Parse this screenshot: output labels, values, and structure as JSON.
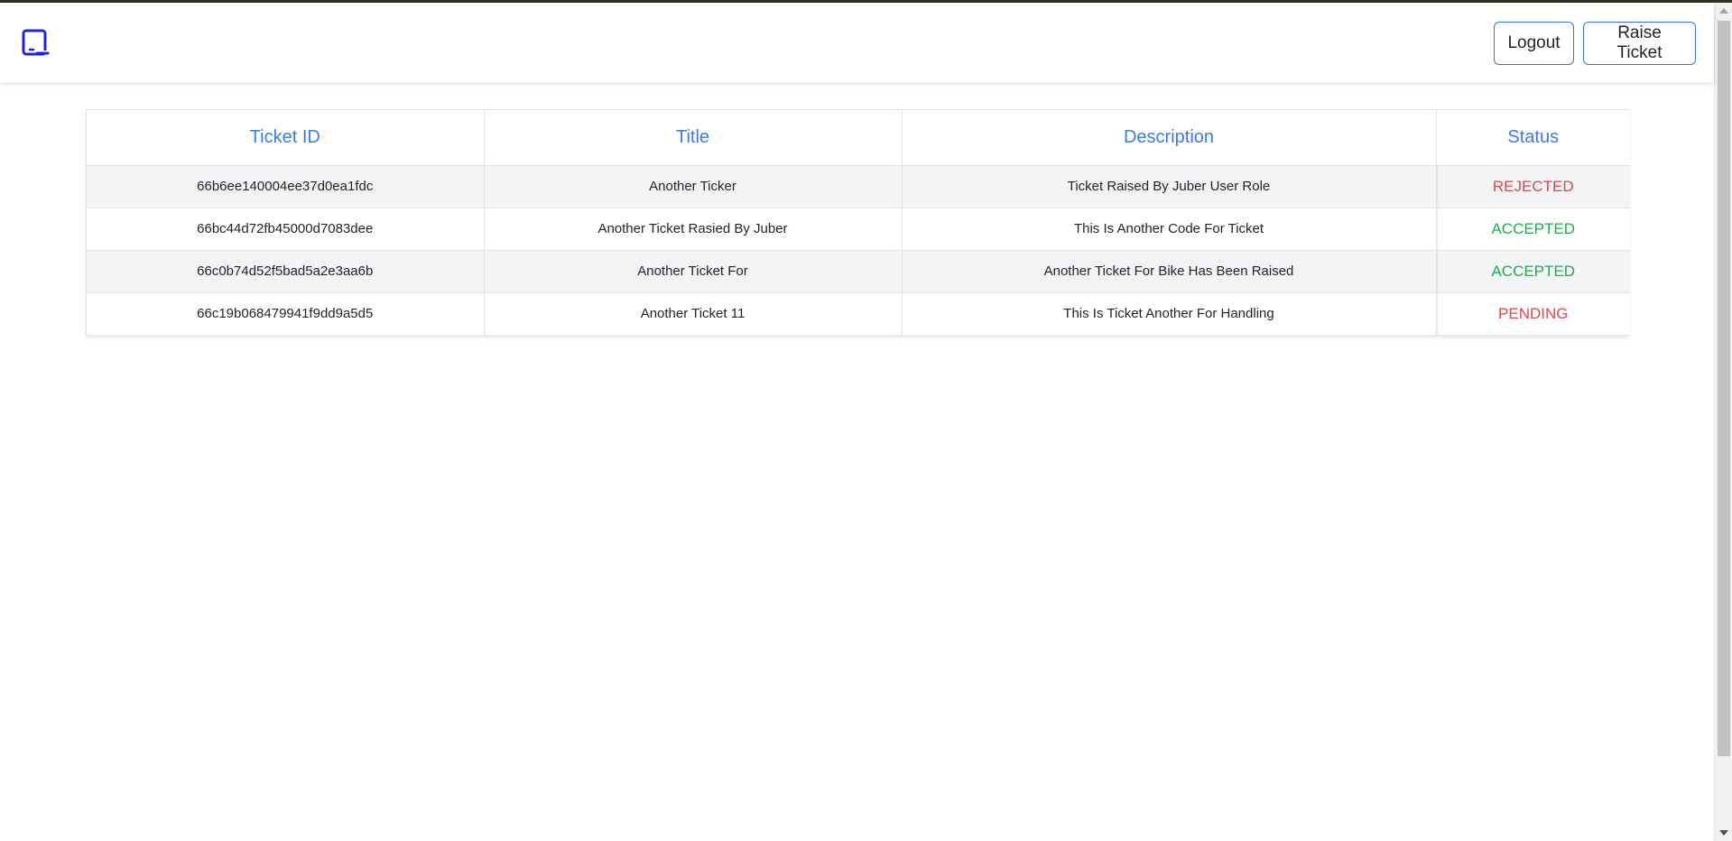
{
  "navbar": {
    "logo_icon": "tablet-icon",
    "logout_label": "Logout",
    "raise_ticket_label": "Raise Ticket",
    "accent": "#3b6fd4"
  },
  "table": {
    "headers": {
      "ticket_id": "Ticket ID",
      "title": "Title",
      "description": "Description",
      "status": "Status"
    },
    "rows": [
      {
        "ticket_id": "66b6ee140004ee37d0ea1fdc",
        "title": "Another Ticker",
        "description": "Ticket Raised By Juber User Role",
        "status": "REJECTED"
      },
      {
        "ticket_id": "66bc44d72fb45000d7083dee",
        "title": "Another Ticket Rasied By Juber",
        "description": "This Is Another Code For Ticket",
        "status": "ACCEPTED"
      },
      {
        "ticket_id": "66c0b74d52f5bad5a2e3aa6b",
        "title": "Another Ticket For",
        "description": "Another Ticket For Bike Has Been Raised",
        "status": "ACCEPTED"
      },
      {
        "ticket_id": "66c19b068479941f9dd9a5d5",
        "title": "Another Ticket 11",
        "description": "This Is Ticket Another For Handling",
        "status": "PENDING"
      }
    ]
  },
  "colors": {
    "header_text": "#3b7be6",
    "rejected": "#e0454c",
    "accepted": "#1fae4b",
    "pending": "#e0454c"
  }
}
